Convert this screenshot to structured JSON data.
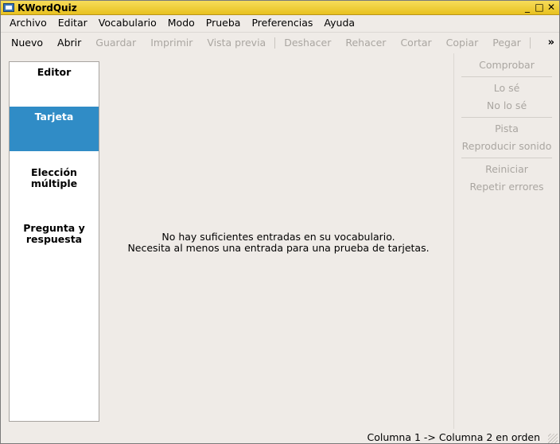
{
  "window": {
    "title": "KWordQuiz",
    "controls": [
      "_",
      "□",
      "✕"
    ]
  },
  "menubar": {
    "items": [
      "Archivo",
      "Editar",
      "Vocabulario",
      "Modo",
      "Prueba",
      "Preferencias",
      "Ayuda"
    ]
  },
  "toolbar": {
    "buttons": [
      {
        "label": "Nuevo",
        "enabled": true
      },
      {
        "label": "Abrir",
        "enabled": true
      },
      {
        "label": "Guardar",
        "enabled": false
      },
      {
        "label": "Imprimir",
        "enabled": false
      },
      {
        "label": "Vista previa",
        "enabled": false
      },
      {
        "label": "Deshacer",
        "enabled": false
      },
      {
        "label": "Rehacer",
        "enabled": false
      },
      {
        "label": "Cortar",
        "enabled": false
      },
      {
        "label": "Copiar",
        "enabled": false
      },
      {
        "label": "Pegar",
        "enabled": false
      }
    ],
    "overflow": "»"
  },
  "sidebar": {
    "items": [
      {
        "label": "Editor",
        "active": false
      },
      {
        "label": "Tarjeta",
        "active": true
      },
      {
        "label": "Elección\nmúltiple",
        "active": false
      },
      {
        "label": "Pregunta y\nrespuesta",
        "active": false
      }
    ]
  },
  "main": {
    "message_line1": "No hay suficientes entradas en su vocabulario.",
    "message_line2": "Necesita al menos una entrada para una prueba de tarjetas."
  },
  "right_panel": {
    "check": "Comprobar",
    "know": "Lo sé",
    "dont_know": "No lo sé",
    "hint": "Pista",
    "play_sound": "Reproducir sonido",
    "restart": "Reiniciar",
    "repeat_errors": "Repetir errores"
  },
  "status": {
    "text": "Columna 1 -> Columna 2 en orden"
  },
  "colors": {
    "title_bar": "#e8c11f",
    "selection": "#308cc6",
    "background": "#efebe7",
    "disabled_text": "#aaa6a1"
  }
}
